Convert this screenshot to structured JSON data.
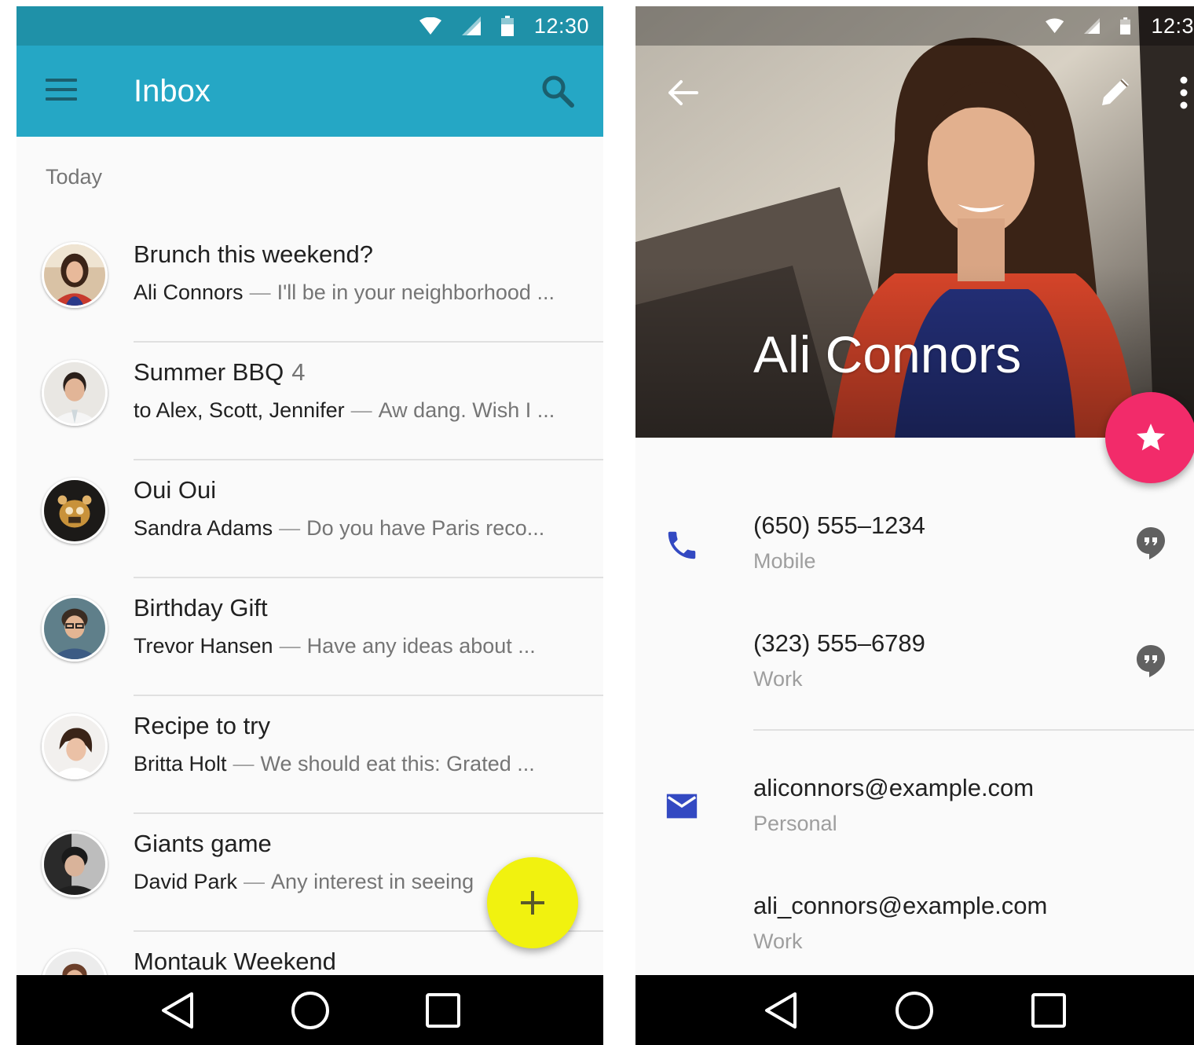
{
  "left_screen": {
    "status_time": "12:30",
    "app_bar": {
      "title": "Inbox",
      "menu_icon": "menu-icon",
      "search_icon": "search-icon"
    },
    "section_label": "Today",
    "messages": [
      {
        "subject": "Brunch this weekend?",
        "count": "",
        "sender": "Ali Connors",
        "preview": "I'll be in your neighborhood ..."
      },
      {
        "subject": "Summer BBQ",
        "count": "4",
        "sender": "to Alex, Scott, Jennifer",
        "preview": "Aw dang. Wish I ..."
      },
      {
        "subject": "Oui Oui",
        "count": "",
        "sender": "Sandra Adams",
        "preview": "Do you have Paris reco..."
      },
      {
        "subject": "Birthday Gift",
        "count": "",
        "sender": "Trevor Hansen",
        "preview": "Have any ideas about ..."
      },
      {
        "subject": "Recipe to try",
        "count": "",
        "sender": "Britta Holt",
        "preview": "We should eat this: Grated ..."
      },
      {
        "subject": "Giants game",
        "count": "",
        "sender": "David Park",
        "preview": "Any interest in seeing"
      },
      {
        "subject": "Montauk Weekend",
        "count": "",
        "sender": "",
        "preview": ""
      }
    ],
    "separator": "—",
    "fab_icon": "plus-icon",
    "colors": {
      "status_bar": "#1f91a8",
      "app_bar": "#25a7c5",
      "fab": "#f1f20f"
    }
  },
  "right_screen": {
    "status_time": "12:3",
    "contact_name": "Ali Connors",
    "favorite_icon": "star-icon",
    "phones": [
      {
        "number": "(650) 555–1234",
        "type": "Mobile"
      },
      {
        "number": "(323) 555–6789",
        "type": "Work"
      }
    ],
    "emails": [
      {
        "address": "aliconnors@example.com",
        "type": "Personal"
      },
      {
        "address": "ali_connors@example.com",
        "type": "Work"
      }
    ],
    "colors": {
      "fab": "#f22b6a",
      "icon_accent": "#3349c2"
    }
  },
  "nav_bar": {
    "back_icon": "nav-back-icon",
    "home_icon": "nav-home-icon",
    "recents_icon": "nav-recents-icon"
  }
}
